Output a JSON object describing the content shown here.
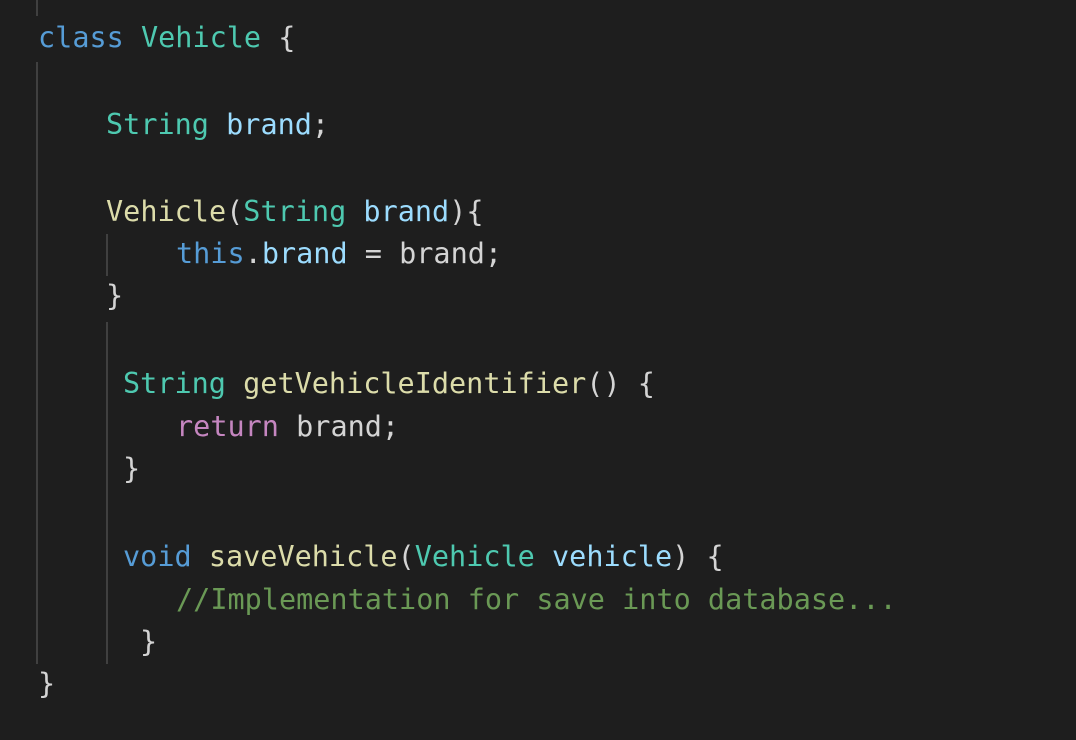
{
  "code": {
    "kw_class": "class",
    "class_name": "Vehicle",
    "open_brace": "{",
    "close_brace": "}",
    "field_type": "String",
    "field_name": "brand",
    "semicolon": ";",
    "ctor_name": "Vehicle",
    "ctor_open_paren": "(",
    "ctor_param_type": "String",
    "ctor_param_name": "brand",
    "ctor_close": "){",
    "kw_this": "this",
    "dot": ".",
    "this_field": "brand",
    "assign": " = ",
    "assign_value": "brand;",
    "method1_return_type": "String",
    "method1_name": "getVehicleIdentifier",
    "method1_parens": "() {",
    "kw_return": "return",
    "return_value": "brand;",
    "kw_void": "void",
    "method2_name": "saveVehicle",
    "method2_open_paren": "(",
    "method2_param_type": "Vehicle",
    "method2_param_name": "vehicle",
    "method2_close": ") {",
    "comment": "//Implementation for save into database..."
  }
}
